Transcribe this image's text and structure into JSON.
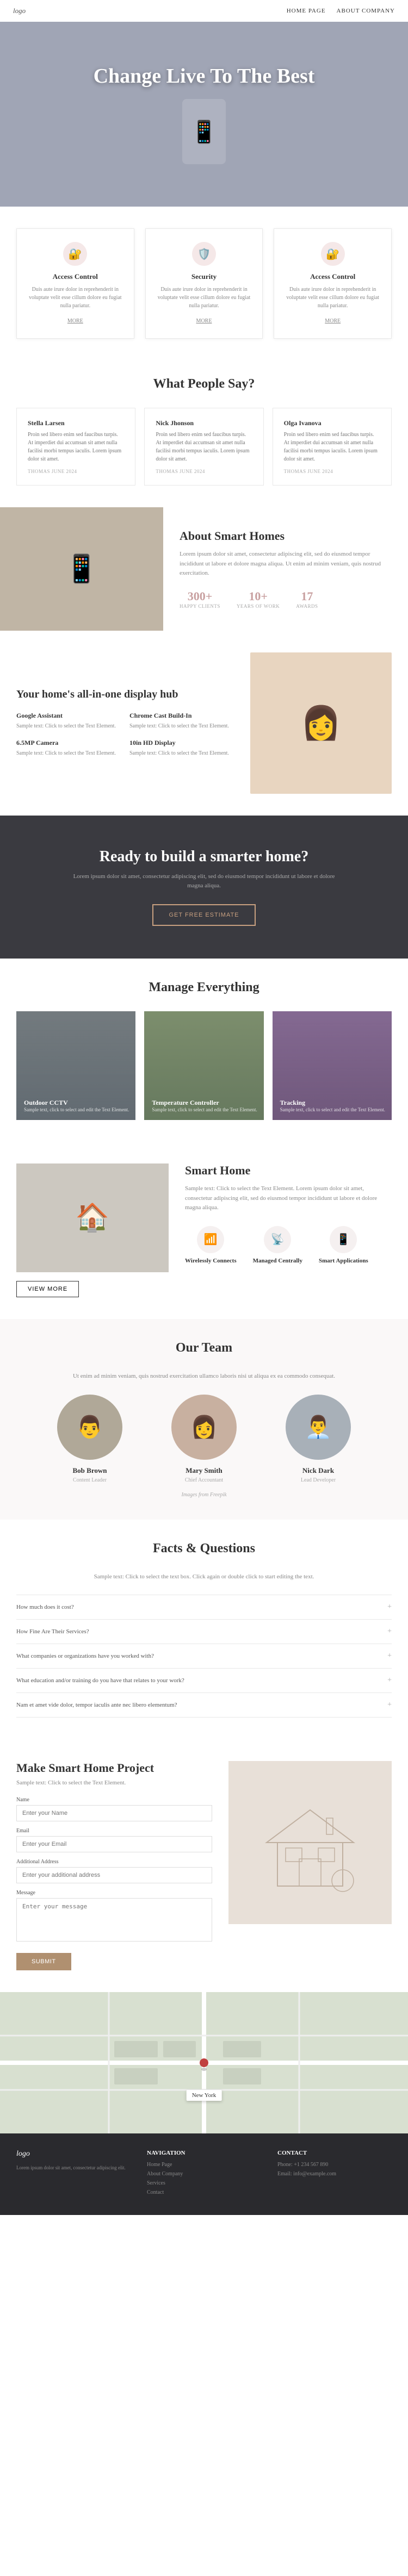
{
  "nav": {
    "logo": "logo",
    "links": [
      "Home Page",
      "About Company"
    ]
  },
  "hero": {
    "title": "Change Live To The Best"
  },
  "features": [
    {
      "title": "Access Control",
      "text": "Duis aute irure dolor in reprehenderit in voluptate velit esse cillum dolore eu fugiat nulla pariatur.",
      "more": "MORE",
      "icon": "🔐"
    },
    {
      "title": "Security",
      "text": "Duis aute irure dolor in reprehenderit in voluptate velit esse cillum dolore eu fugiat nulla pariatur.",
      "more": "MORE",
      "icon": "🛡️"
    },
    {
      "title": "Access Control",
      "text": "Duis aute irure dolor in reprehenderit in voluptate velit esse cillum dolore eu fugiat nulla pariatur.",
      "more": "MORE",
      "icon": "🔐"
    }
  ],
  "testimonials_section": {
    "title": "What People Say?",
    "items": [
      {
        "name": "Stella Larsen",
        "text": "Proin sed libero enim sed faucibus turpis. At imperdiet dui accumsan sit amet nulla facilisi morbi tempus iaculis. Lorem ipsum dolor sit amet.",
        "date": "THOMAS JUNE 2024"
      },
      {
        "name": "Nick Jhonson",
        "text": "Proin sed libero enim sed faucibus turpis. At imperdiet dui accumsan sit amet nulla facilisi morbi tempus iaculis. Lorem ipsum dolor sit amet.",
        "date": "THOMAS JUNE 2024"
      },
      {
        "name": "Olga Ivanova",
        "text": "Proin sed libero enim sed faucibus turpis. At imperdiet dui accumsan sit amet nulla facilisi morbi tempus iaculis. Lorem ipsum dolor sit amet.",
        "date": "THOMAS JUNE 2024"
      }
    ]
  },
  "about": {
    "title": "About Smart Homes",
    "text": "Lorem ipsum dolor sit amet, consectetur adipiscing elit, sed do eiusmod tempor incididunt ut labore et dolore magna aliqua. Ut enim ad minim veniam, quis nostrud exercitation.",
    "stats": [
      {
        "num": "300+",
        "label": "HAPPY CLIENTS"
      },
      {
        "num": "10+",
        "label": "YEARS OF WORK"
      },
      {
        "num": "17",
        "label": "AWARDS"
      }
    ]
  },
  "hub": {
    "title": "Your home's all-in-one display hub",
    "items": [
      {
        "name": "Google Assistant",
        "text": "Sample text: Click to select the Text Element."
      },
      {
        "name": "Chrome Cast Build-In",
        "text": "Sample text: Click to select the Text Element."
      },
      {
        "name": "6.5MP Camera",
        "text": "Sample text: Click to select the Text Element."
      },
      {
        "name": "10in HD Display",
        "text": "Sample text: Click to select the Text Element."
      }
    ]
  },
  "cta": {
    "title": "Ready to build a smarter home?",
    "text": "Lorem ipsum dolor sit amet, consectetur adipiscing elit, sed do eiusmod tempor incididunt ut labore et dolore magna aliqua.",
    "button": "GET FREE ESTIMATE"
  },
  "manage": {
    "title": "Manage Everything",
    "cards": [
      {
        "label": "Outdoor CCTV",
        "text": "Sample text, click to select and edit the Text Element."
      },
      {
        "label": "Temperature Controller",
        "text": "Sample text, click to select and edit the Text Element."
      },
      {
        "label": "Tracking",
        "text": "Sample text, click to select and edit the Text Element."
      }
    ]
  },
  "smart": {
    "title": "Smart Home",
    "text": "Sample text: Click to select the Text Element. Lorem ipsum dolor sit amet, consectetur adipiscing elit, sed do eiusmod tempor incididunt ut labore et dolore magna aliqua.",
    "view_more": "VIEW MORE",
    "icons": [
      {
        "label": "Wirelessly Connects",
        "icon": "📶"
      },
      {
        "label": "Managed Centrally",
        "icon": "📡"
      },
      {
        "label": "Smart Applications",
        "icon": "📱"
      }
    ]
  },
  "team": {
    "title": "Our Team",
    "intro": "Ut enim ad minim veniam, quis nostrud exercitation ullamco laboris nisi ut aliqua ex ea commodo consequat.",
    "members": [
      {
        "name": "Bob Brown",
        "role": "Content Leader"
      },
      {
        "name": "Mary Smith",
        "role": "Chief Accountant"
      },
      {
        "name": "Nick Dark",
        "role": "Lead Developer"
      }
    ],
    "credit": "Images from Freepik"
  },
  "faq": {
    "title": "Facts & Questions",
    "intro": "Sample text: Click to select the text box. Click again or double click to start editing the text.",
    "items": [
      {
        "q": "How much does it cost?"
      },
      {
        "q": "How Fine Are Their Services?"
      },
      {
        "q": "What companies or organizations have you worked with?"
      },
      {
        "q": "What education and/or training do you have that relates to your work?"
      },
      {
        "q": "Nam et amet vide dolor, tempor iaculis ante nec libero elementum?"
      }
    ]
  },
  "project": {
    "title": "Make Smart Home Project",
    "intro": "Sample text: Click to select the Text Element.",
    "form": {
      "name_label": "Name",
      "name_placeholder": "Enter your Name",
      "email_label": "Email",
      "email_placeholder": "Enter your Email",
      "phone_label": "Additional Address",
      "phone_placeholder": "Enter your additional address",
      "message_label": "Message",
      "message_placeholder": "Enter your message",
      "submit": "SUBMIT"
    }
  },
  "map": {
    "label": "New York"
  },
  "footer": {
    "logo": "logo",
    "text": "Lorem ipsum dolor sit amet, consectetur adipiscing elit.",
    "cols": [
      {
        "heading": "Navigation",
        "links": [
          "Home Page",
          "About Company",
          "Services",
          "Contact"
        ]
      },
      {
        "heading": "Contact",
        "links": [
          "Phone: +1 234 567 890",
          "Email: info@example.com"
        ]
      }
    ]
  }
}
